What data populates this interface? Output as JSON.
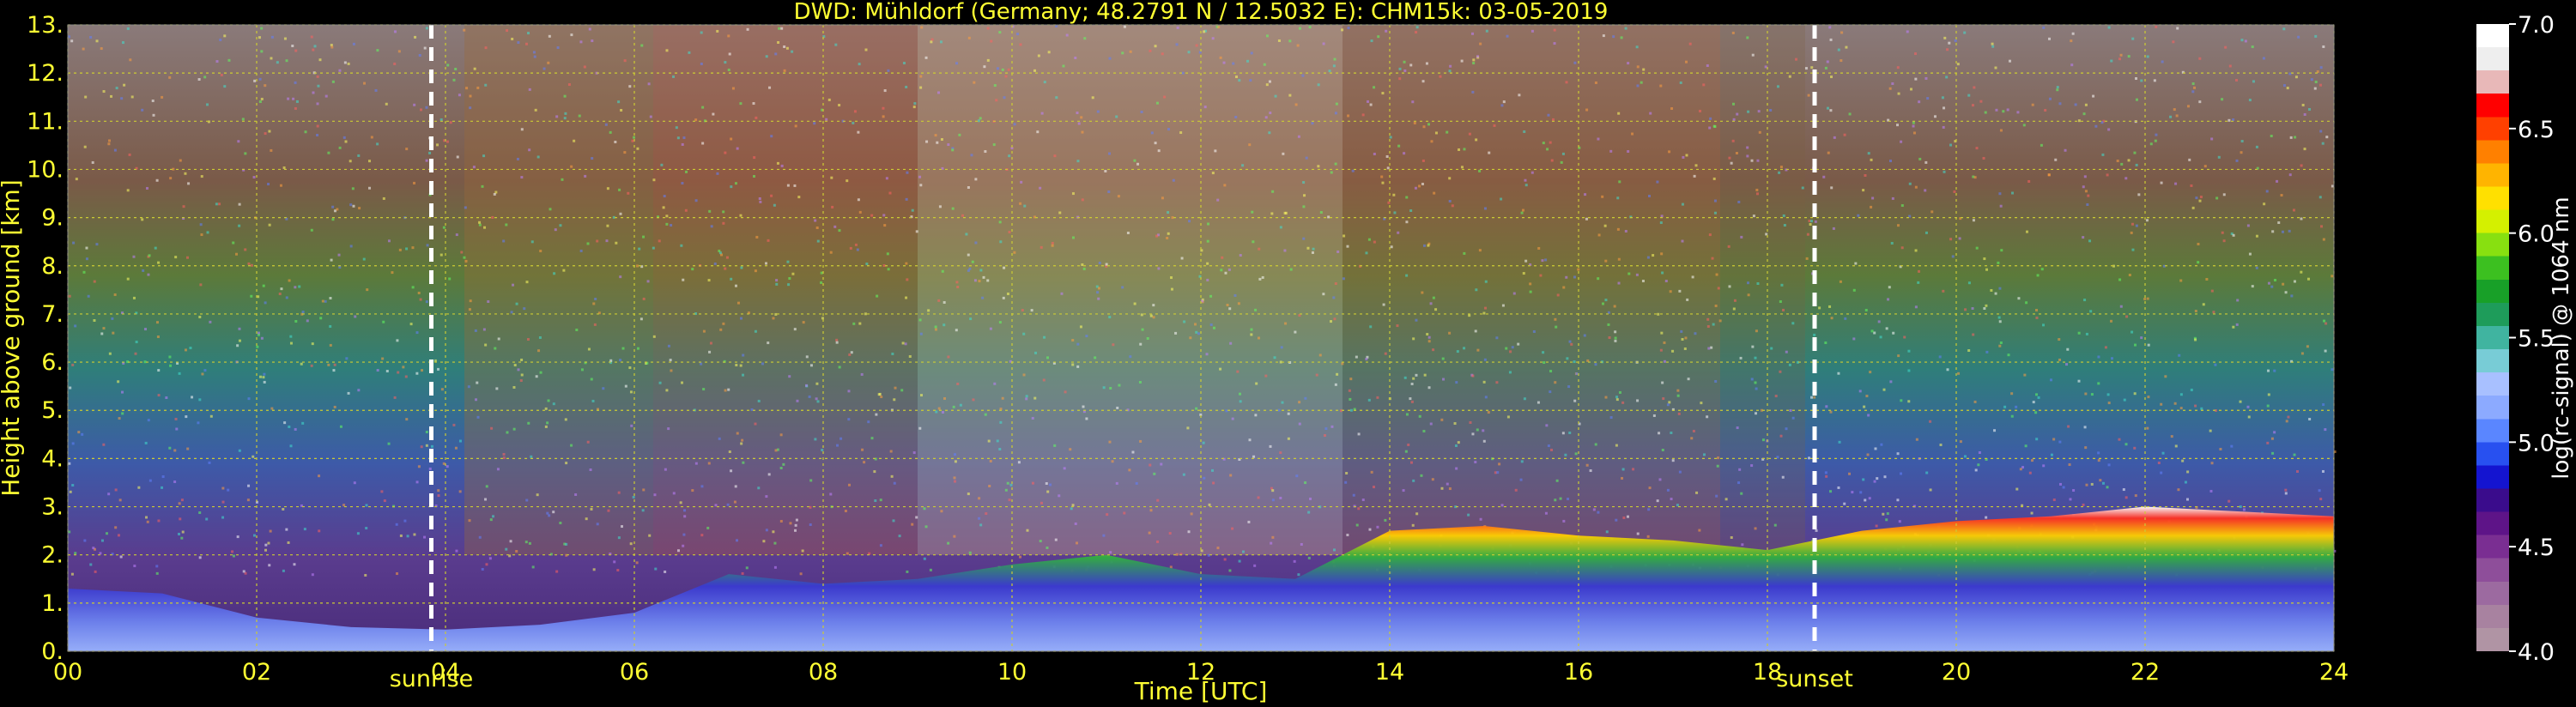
{
  "chart_data": {
    "type": "heatmap",
    "title": "DWD: Mühldorf (Germany; 48.2791 N / 12.5032 E):    CHM15k: 03-05-2019",
    "xlabel": "Time [UTC]",
    "ylabel": "Height above ground [km]",
    "xlim": [
      0,
      24
    ],
    "ylim": [
      0,
      13
    ],
    "xticks": [
      {
        "value": 0,
        "label": "00"
      },
      {
        "value": 2,
        "label": "02"
      },
      {
        "value": 4,
        "label": "04"
      },
      {
        "value": 6,
        "label": "06"
      },
      {
        "value": 8,
        "label": "08"
      },
      {
        "value": 10,
        "label": "10"
      },
      {
        "value": 12,
        "label": "12"
      },
      {
        "value": 14,
        "label": "14"
      },
      {
        "value": 16,
        "label": "16"
      },
      {
        "value": 18,
        "label": "18"
      },
      {
        "value": 20,
        "label": "20"
      },
      {
        "value": 22,
        "label": "22"
      },
      {
        "value": 24,
        "label": "24"
      }
    ],
    "yticks": [
      {
        "value": 0,
        "label": "0."
      },
      {
        "value": 1,
        "label": "1."
      },
      {
        "value": 2,
        "label": "2."
      },
      {
        "value": 3,
        "label": "3."
      },
      {
        "value": 4,
        "label": "4."
      },
      {
        "value": 5,
        "label": "5."
      },
      {
        "value": 6,
        "label": "6."
      },
      {
        "value": 7,
        "label": "7."
      },
      {
        "value": 8,
        "label": "8."
      },
      {
        "value": 9,
        "label": "9."
      },
      {
        "value": 10,
        "label": "10."
      },
      {
        "value": 11,
        "label": "11."
      },
      {
        "value": 12,
        "label": "12."
      },
      {
        "value": 13,
        "label": "13."
      }
    ],
    "grid": true,
    "annotations": [
      {
        "label": "sunrise",
        "time": 3.85
      },
      {
        "label": "sunset",
        "time": 18.5
      }
    ],
    "colorbar": {
      "label": "log(rc-signal) @ 1064 nm",
      "range": [
        4.0,
        7.0
      ],
      "ticks": [
        {
          "value": 4.0,
          "label": "4.0"
        },
        {
          "value": 4.5,
          "label": "4.5"
        },
        {
          "value": 5.0,
          "label": "5.0"
        },
        {
          "value": 5.5,
          "label": "5.5"
        },
        {
          "value": 6.0,
          "label": "6.0"
        },
        {
          "value": 6.5,
          "label": "6.5"
        },
        {
          "value": 7.0,
          "label": "7.0"
        }
      ],
      "colors": [
        "#b094a4",
        "#a882a0",
        "#9c6aa0",
        "#8e4e9a",
        "#7a2e92",
        "#5e1488",
        "#3a0c8c",
        "#1414d0",
        "#2850f0",
        "#5a86ff",
        "#8caaff",
        "#a8c0ff",
        "#78ccd6",
        "#40b4a0",
        "#1e9c5a",
        "#18a028",
        "#3cc020",
        "#88e010",
        "#d4f000",
        "#ffe000",
        "#ffb400",
        "#ff8000",
        "#ff4000",
        "#ff0000",
        "#e8b8b8",
        "#eeeeee",
        "#ffffff"
      ]
    },
    "boundary_layer_top_km": [
      {
        "time": 0.0,
        "top": 1.3
      },
      {
        "time": 1.0,
        "top": 1.2
      },
      {
        "time": 2.0,
        "top": 0.7
      },
      {
        "time": 3.0,
        "top": 0.5
      },
      {
        "time": 4.0,
        "top": 0.45
      },
      {
        "time": 5.0,
        "top": 0.55
      },
      {
        "time": 6.0,
        "top": 0.8
      },
      {
        "time": 6.5,
        "top": 1.2
      },
      {
        "time": 7.0,
        "top": 1.6
      },
      {
        "time": 8.0,
        "top": 1.4
      },
      {
        "time": 9.0,
        "top": 1.5
      },
      {
        "time": 10.0,
        "top": 1.8
      },
      {
        "time": 11.0,
        "top": 2.0
      },
      {
        "time": 12.0,
        "top": 1.6
      },
      {
        "time": 13.0,
        "top": 1.5
      },
      {
        "time": 14.0,
        "top": 2.5
      },
      {
        "time": 15.0,
        "top": 2.6
      },
      {
        "time": 16.0,
        "top": 2.4
      },
      {
        "time": 17.0,
        "top": 2.3
      },
      {
        "time": 18.0,
        "top": 2.1
      },
      {
        "time": 19.0,
        "top": 2.5
      },
      {
        "time": 20.0,
        "top": 2.7
      },
      {
        "time": 21.0,
        "top": 2.8
      },
      {
        "time": 22.0,
        "top": 3.0
      },
      {
        "time": 23.0,
        "top": 2.9
      },
      {
        "time": 24.0,
        "top": 2.8
      }
    ]
  }
}
